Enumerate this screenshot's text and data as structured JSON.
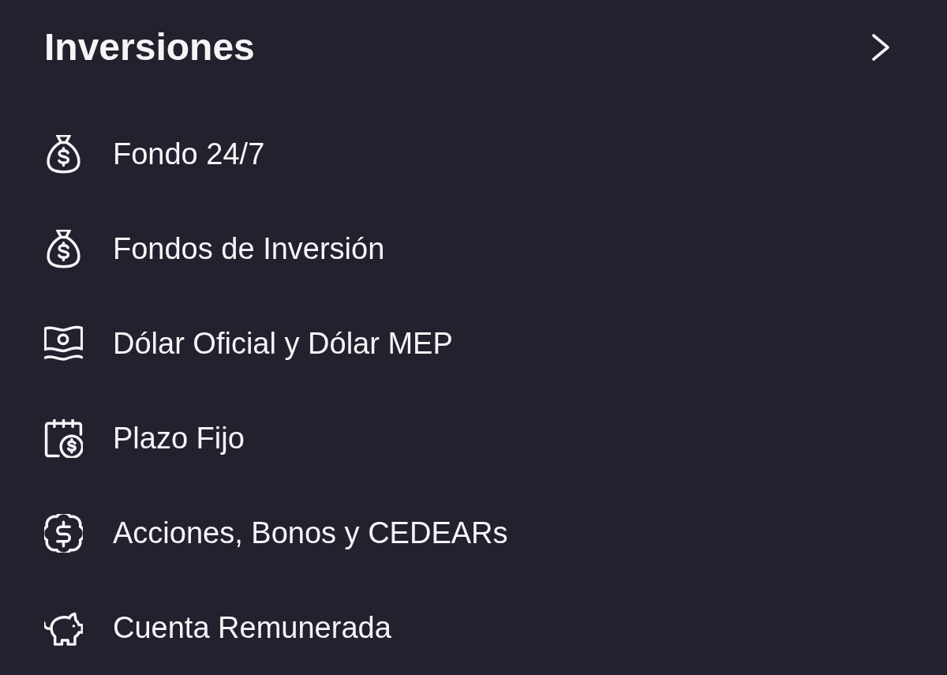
{
  "header": {
    "title": "Inversiones"
  },
  "items": [
    {
      "label": "Fondo 24/7"
    },
    {
      "label": "Fondos de Inversión"
    },
    {
      "label": "Dólar Oficial y Dólar MEP"
    },
    {
      "label": "Plazo Fijo"
    },
    {
      "label": "Acciones, Bonos y CEDEARs"
    },
    {
      "label": "Cuenta Remunerada"
    }
  ]
}
